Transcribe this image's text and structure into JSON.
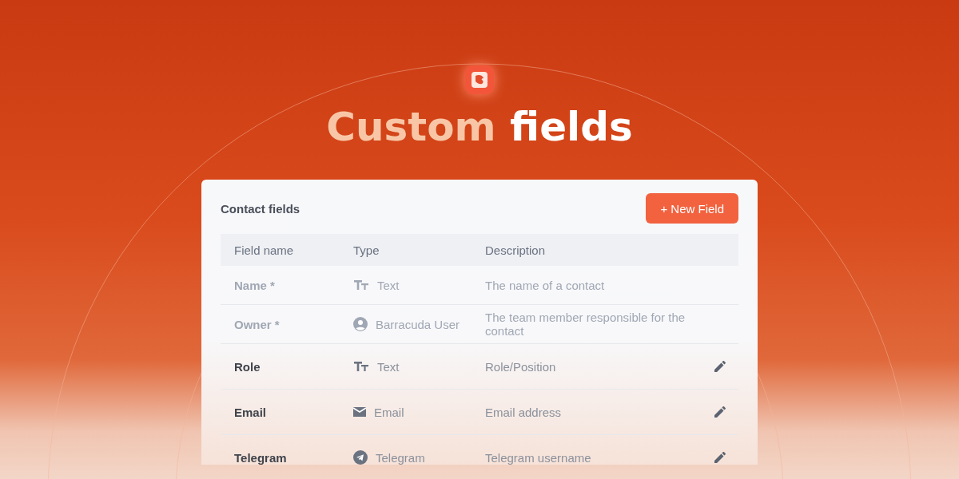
{
  "title": {
    "highlight": "Custom",
    "rest": "fields"
  },
  "card": {
    "title": "Contact fields",
    "button": "+ New Field"
  },
  "table": {
    "columns": [
      "Field name",
      "Type",
      "Description"
    ],
    "rows": [
      {
        "name": "Name *",
        "kind": "text",
        "type": "Text",
        "description": "The name of a contact",
        "disabled": true
      },
      {
        "name": "Owner *",
        "kind": "user",
        "type": "Barracuda User",
        "description": "The team member responsible for the contact",
        "disabled": true
      },
      {
        "name": "Role",
        "kind": "text",
        "type": "Text",
        "description": "Role/Position",
        "disabled": false
      },
      {
        "name": "Email",
        "kind": "email",
        "type": "Email",
        "description": "Email address",
        "disabled": false
      },
      {
        "name": "Telegram",
        "kind": "telegram",
        "type": "Telegram",
        "description": "Telegram username",
        "disabled": false
      }
    ]
  }
}
